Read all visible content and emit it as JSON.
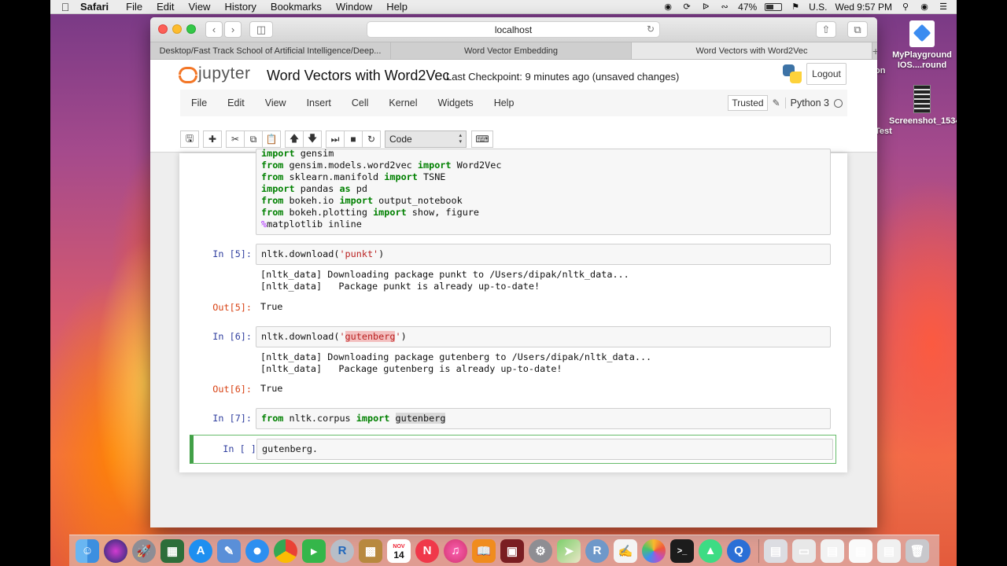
{
  "menubar": {
    "apple": "",
    "app_name": "Safari",
    "items": [
      "File",
      "Edit",
      "View",
      "History",
      "Bookmarks",
      "Window",
      "Help"
    ],
    "battery": "47%",
    "input_source": "U.S.",
    "clock": "Wed 9:57 PM"
  },
  "desktop": {
    "icons": [
      {
        "label": "MyPlayground IOS....round",
        "icon": "swift-playground-icon"
      },
      {
        "label": "Screenshot_15342...11.png",
        "icon": "screenshot-file-icon"
      }
    ],
    "peek_text_1": "on",
    "peek_text_2": "Test"
  },
  "safari": {
    "address": "localhost",
    "tabs": [
      {
        "label": "Desktop/Fast Track School of Artificial Intelligence/Deep...",
        "active": false
      },
      {
        "label": "Word Vector Embedding",
        "active": false
      },
      {
        "label": "Word Vectors with Word2Vec",
        "active": true
      }
    ],
    "new_tab": "+"
  },
  "jupyter": {
    "logo_text": "jupyter",
    "notebook_title": "Word Vectors with Word2Vec",
    "checkpoint": "Last Checkpoint: 9 minutes ago (unsaved changes)",
    "logout": "Logout",
    "menu": [
      "File",
      "Edit",
      "View",
      "Insert",
      "Cell",
      "Kernel",
      "Widgets",
      "Help"
    ],
    "trusted": "Trusted",
    "kernel": "Python 3",
    "cell_type": "Code"
  },
  "cells": {
    "c1": {
      "lines": [
        {
          "kw1": "import",
          "rest": " gensim"
        },
        {
          "kw1": "from",
          "mid": " gensim.models.word2vec ",
          "kw2": "import",
          "rest": " Word2Vec"
        },
        {
          "kw1": "from",
          "mid": " sklearn.manifold ",
          "kw2": "import",
          "rest": " TSNE"
        },
        {
          "kw1": "import",
          "mid": " pandas ",
          "kw2": "as",
          "rest": " pd"
        },
        {
          "kw1": "from",
          "mid": " bokeh.io ",
          "kw2": "import",
          "rest": " output_notebook"
        },
        {
          "kw1": "from",
          "mid": " bokeh.plotting ",
          "kw2": "import",
          "rest": " show, figure"
        },
        {
          "magic": "%",
          "rest": "matplotlib inline"
        }
      ]
    },
    "c5": {
      "prompt_in": "In [5]:",
      "code_pre": "nltk.download(",
      "code_str": "'punkt'",
      "code_post": ")",
      "stdout": [
        "[nltk_data] Downloading package punkt to /Users/dipak/nltk_data...",
        "[nltk_data]   Package punkt is already up-to-date!"
      ],
      "prompt_out": "Out[5]:",
      "result": "True"
    },
    "c6": {
      "prompt_in": "In [6]:",
      "code_pre": "nltk.download(",
      "code_q1": "'",
      "code_str": "gutenberg",
      "code_q2": "'",
      "code_post": ")",
      "stdout": [
        "[nltk_data] Downloading package gutenberg to /Users/dipak/nltk_data...",
        "[nltk_data]   Package gutenberg is already up-to-date!"
      ],
      "prompt_out": "Out[6]:",
      "result": "True"
    },
    "c7": {
      "prompt_in": "In [7]:",
      "kw1": "from",
      "mid": " nltk.corpus ",
      "kw2": "import",
      "sp": " ",
      "name": "gutenberg"
    },
    "c8": {
      "prompt_in": "In [ ]:",
      "code": "gutenberg."
    }
  },
  "dock": {
    "calendar_month": "NOV",
    "calendar_day": "14",
    "r_label": "R"
  }
}
